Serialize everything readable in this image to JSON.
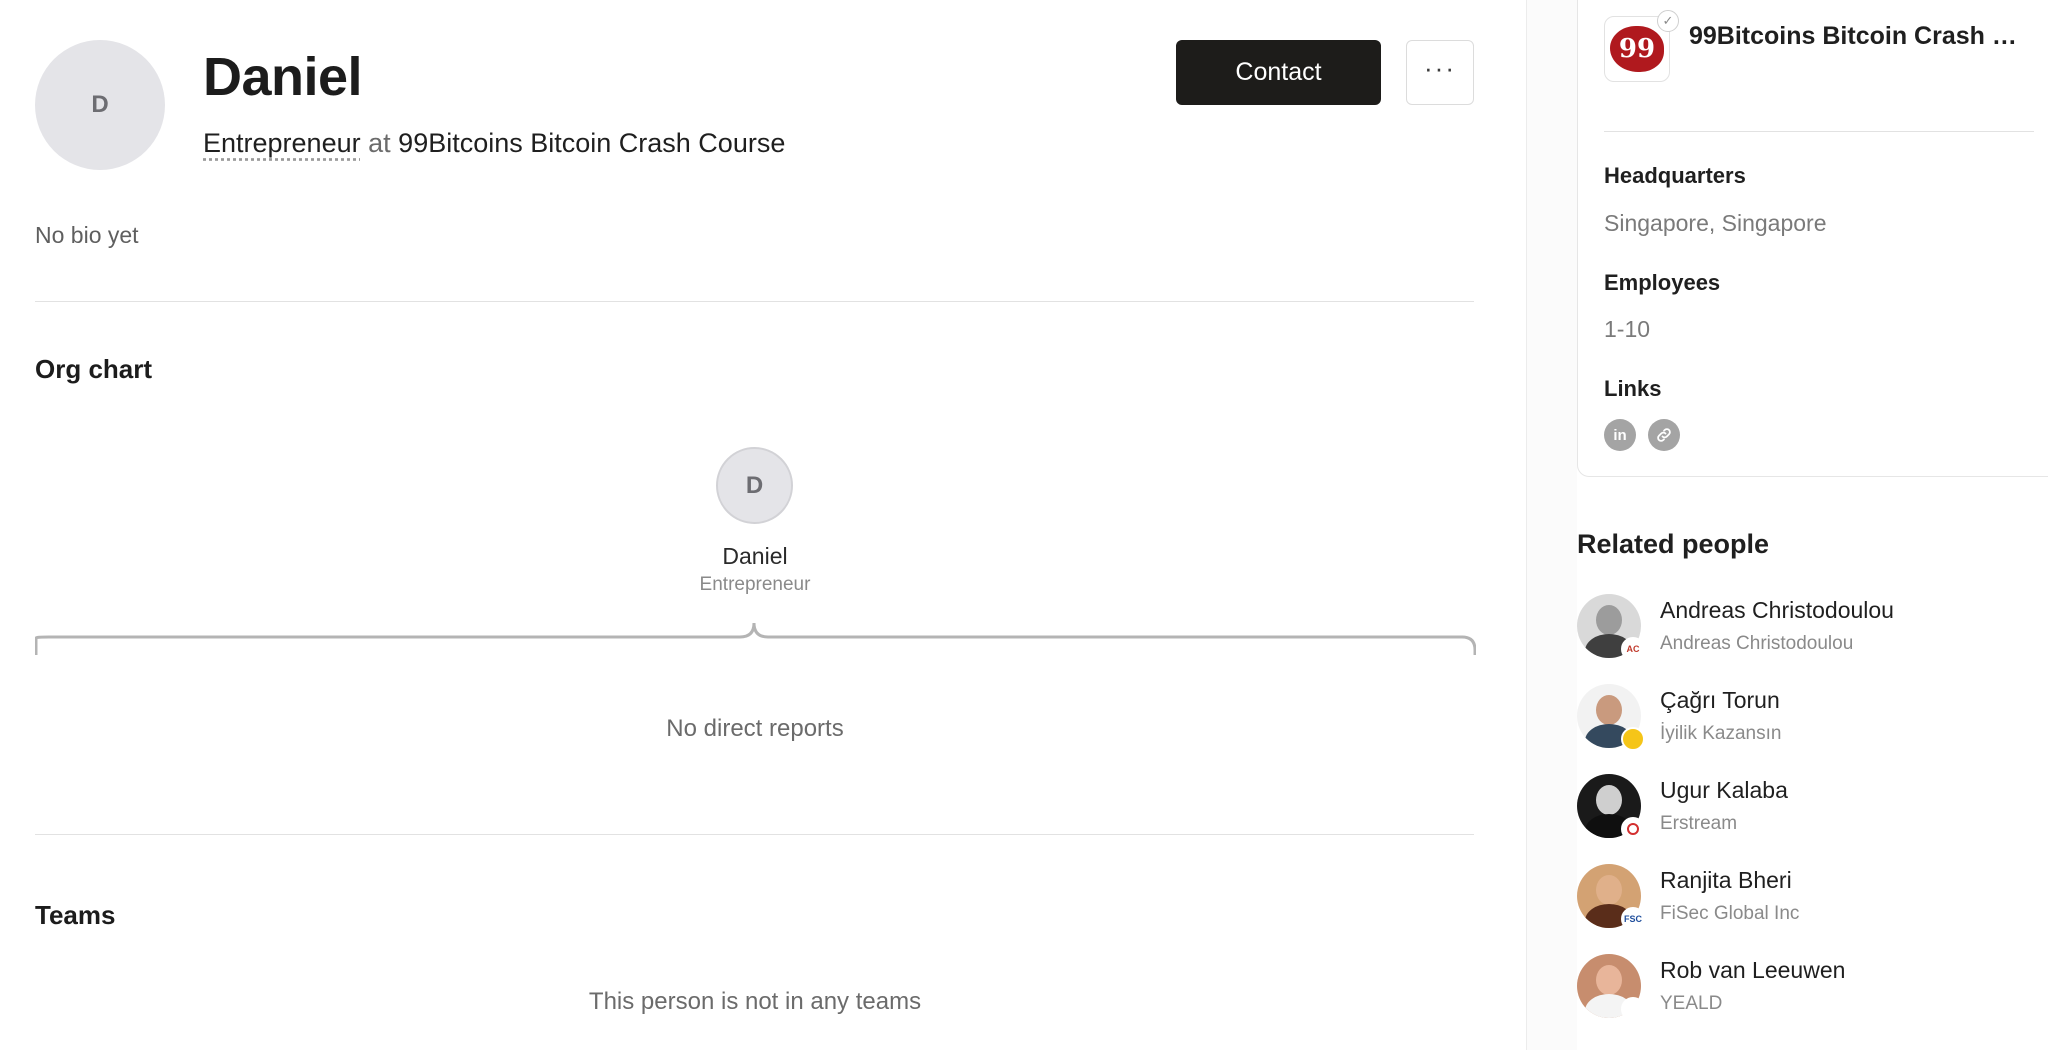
{
  "profile": {
    "avatar_initial": "D",
    "name": "Daniel",
    "role": "Entrepreneur",
    "at_word": "at",
    "company": "99Bitcoins Bitcoin Crash Course",
    "bio": "No bio yet"
  },
  "actions": {
    "contact_label": "Contact",
    "more_label": "···"
  },
  "org_chart": {
    "title": "Org chart",
    "node_initial": "D",
    "node_name": "Daniel",
    "node_role": "Entrepreneur",
    "empty_text": "No direct reports"
  },
  "teams": {
    "title": "Teams",
    "empty_text": "This person is not in any teams"
  },
  "company_card": {
    "logo_text": "99",
    "name": "99Bitcoins Bitcoin Crash C...",
    "headquarters_label": "Headquarters",
    "headquarters_value": "Singapore, Singapore",
    "employees_label": "Employees",
    "employees_value": "1-10",
    "links_label": "Links",
    "links": [
      {
        "icon": "linkedin-icon",
        "glyph": "in"
      },
      {
        "icon": "link-icon",
        "glyph": "🔗"
      }
    ]
  },
  "related_people": {
    "title": "Related people",
    "people": [
      {
        "name": "Andreas Christodoulou",
        "company": "Andreas Christodoulou",
        "badge": "AC"
      },
      {
        "name": "Çağrı Torun",
        "company": "İyilik Kazansın",
        "badge": ""
      },
      {
        "name": "Ugur Kalaba",
        "company": "Erstream",
        "badge": ""
      },
      {
        "name": "Ranjita Bheri",
        "company": "FiSec Global Inc",
        "badge": "FSC"
      },
      {
        "name": "Rob van Leeuwen",
        "company": "YEALD",
        "badge": ""
      }
    ]
  },
  "colors": {
    "primary_button": "#1d1c1a",
    "avatar_bg": "#e4e4e8",
    "company_logo": "#b0191e"
  }
}
